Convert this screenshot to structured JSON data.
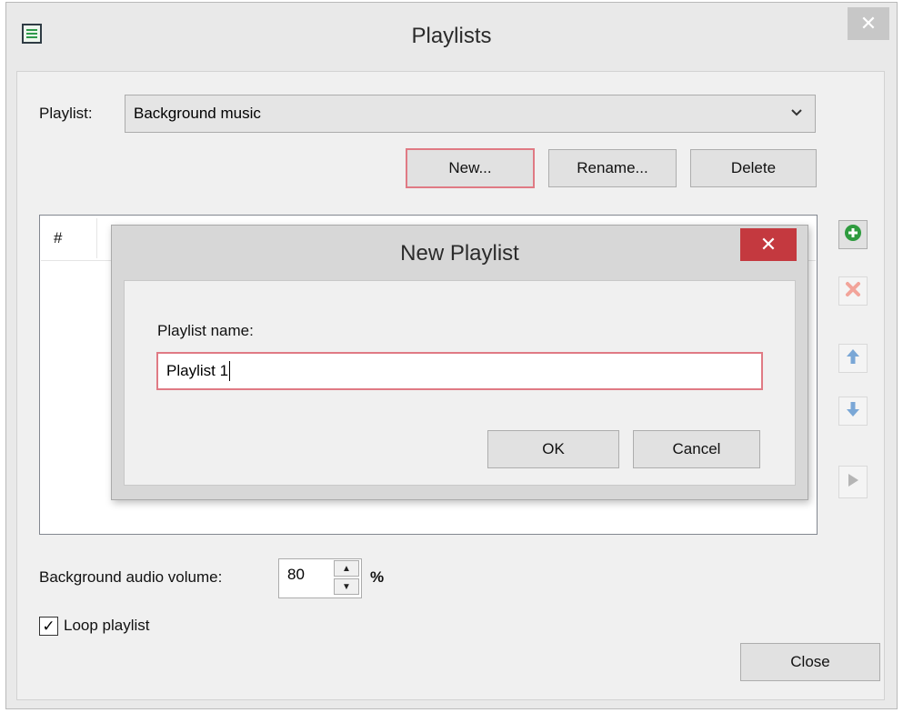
{
  "window": {
    "title": "Playlists",
    "close_glyph": "✕"
  },
  "playlist": {
    "label": "Playlist:",
    "selected": "Background music",
    "buttons": {
      "new": "New...",
      "rename": "Rename...",
      "delete": "Delete"
    }
  },
  "list": {
    "columns": [
      "#"
    ]
  },
  "side_buttons": [
    {
      "icon": "add-icon",
      "enabled": true,
      "color": "#2e9b3e"
    },
    {
      "icon": "remove-icon",
      "enabled": false,
      "color": "#f2a49a"
    },
    {
      "icon": "arrow-up-icon",
      "enabled": false,
      "color": "#7aa7d6"
    },
    {
      "icon": "arrow-down-icon",
      "enabled": false,
      "color": "#7aa7d6"
    },
    {
      "icon": "play-icon",
      "enabled": false,
      "color": "#b5b5b5"
    }
  ],
  "dialog": {
    "title": "New Playlist",
    "close_glyph": "✕",
    "field_label": "Playlist name:",
    "field_value": "Playlist 1",
    "ok": "OK",
    "cancel": "Cancel"
  },
  "volume": {
    "label": "Background audio volume:",
    "value": "80",
    "unit": "%"
  },
  "loop": {
    "label": "Loop playlist",
    "checked": true
  },
  "footer": {
    "close": "Close"
  },
  "colors": {
    "focus_border": "#e07a84",
    "dialog_close_bg": "#c4393f",
    "window_close_bg": "#c7c7c7"
  }
}
